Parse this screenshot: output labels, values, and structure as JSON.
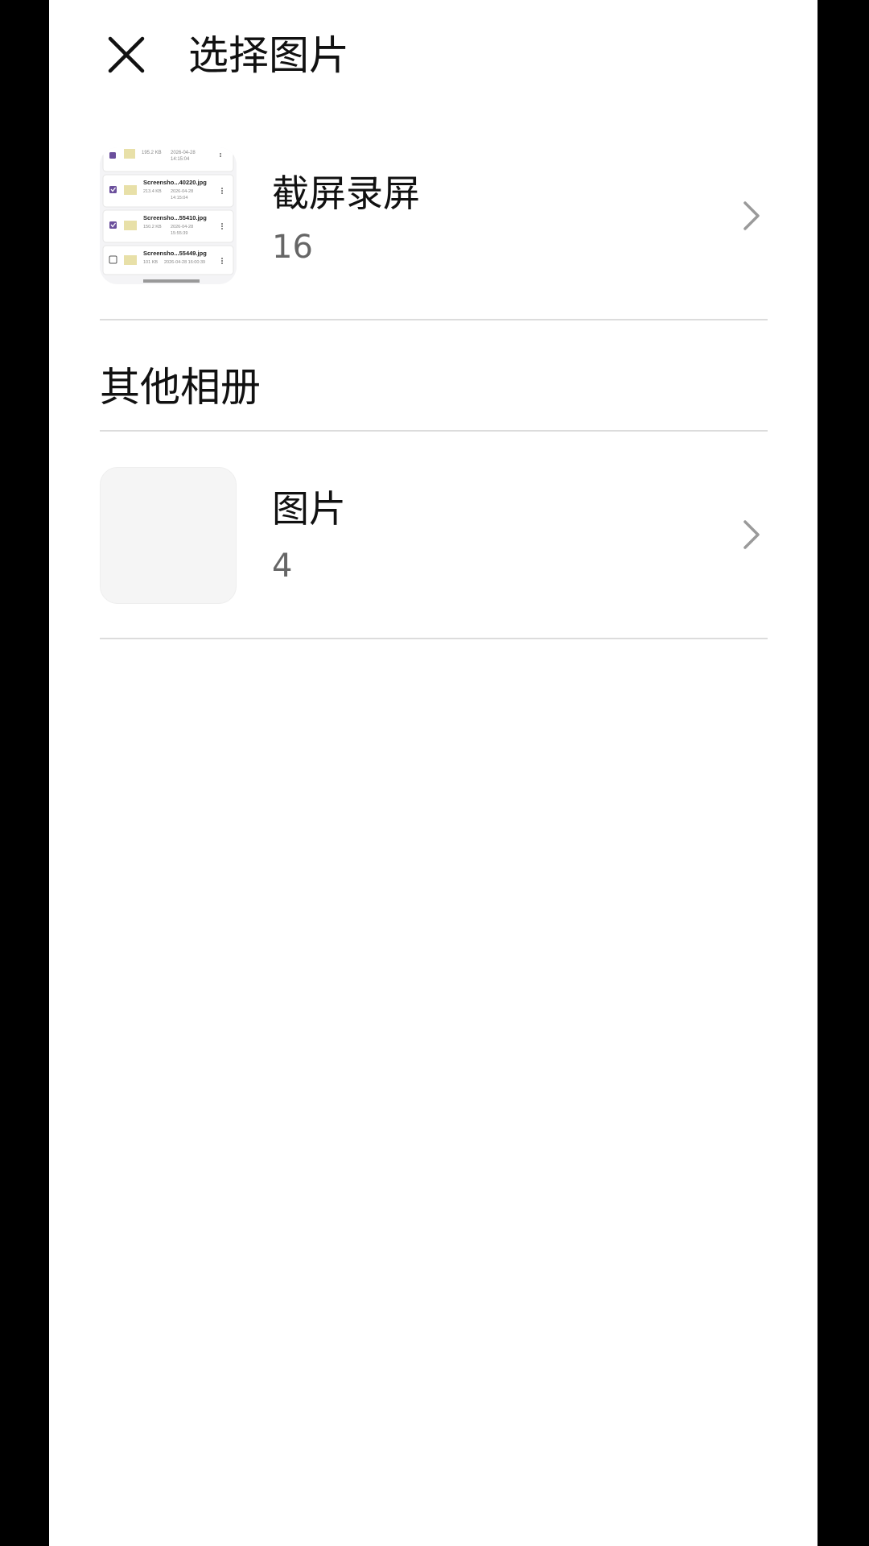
{
  "header": {
    "close_icon": "close-icon",
    "title": "选择图片"
  },
  "albums": [
    {
      "name": "截屏录屏",
      "count": "16",
      "thumbnail": {
        "rows": [
          {
            "name": "",
            "size": "195.2 KB",
            "date": "2026-04-28",
            "time": "14:15:04",
            "checked": true
          },
          {
            "name": "Screensho...40220.jpg",
            "size": "213.4 KB",
            "date": "2026-04-28",
            "time": "14:15:04",
            "checked": true
          },
          {
            "name": "Screensho...55410.jpg",
            "size": "150.2 KB",
            "date": "2026-04-28",
            "time": "15:55:39",
            "checked": true
          },
          {
            "name": "Screensho...55449.jpg",
            "size": "101 KB",
            "date": "2026-04-28 16:00:39",
            "time": "",
            "checked": false
          }
        ]
      }
    }
  ],
  "other_section": {
    "title": "其他相册",
    "albums": [
      {
        "name": "图片",
        "count": "4"
      }
    ]
  },
  "colors": {
    "background": "#ffffff",
    "divider": "#dcdcdc",
    "text_primary": "#111111",
    "text_secondary": "#666666",
    "chevron": "#9a9a9a",
    "checkbox_accent": "#6b4f9c"
  }
}
